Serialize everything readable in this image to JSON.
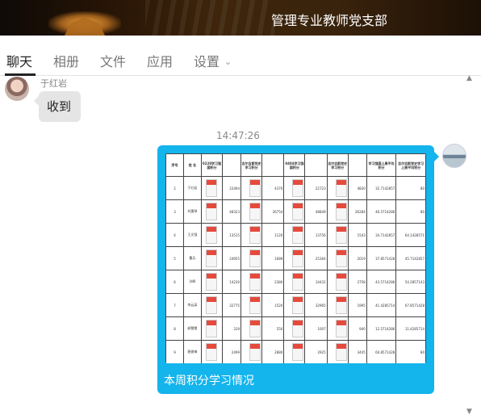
{
  "banner": {
    "title": "管理专业教师党支部"
  },
  "tabs": [
    {
      "label": "聊天",
      "active": true
    },
    {
      "label": "相册"
    },
    {
      "label": "文件"
    },
    {
      "label": "应用"
    },
    {
      "label": "设置"
    }
  ],
  "messages": [
    {
      "sender": "于红岩",
      "text": "收到"
    },
    {
      "time": "14:47:26",
      "caption": "本周积分学习情况"
    }
  ],
  "sheet": {
    "headers": [
      "序号",
      "姓 名",
      "0228学习强国积分",
      "",
      "吉尔吉斯党史学习积分",
      "",
      "0404学习强国积分",
      "",
      "吉尔吉斯党史学习积分",
      "",
      "学习强国上周平均积分",
      "吉尔吉斯党史学习上周平均积分"
    ],
    "rows": [
      [
        "2",
        "于红岩",
        "",
        "22494",
        "",
        "4370",
        "",
        "22723",
        "",
        "4830",
        "32.7142857",
        "80"
      ],
      [
        "3",
        "刘惠琴",
        "",
        "48323",
        "",
        "26754",
        "",
        "48849",
        "",
        "26284",
        "46.5714286",
        "80"
      ],
      [
        "4",
        "王文强",
        "",
        "13515",
        "",
        "1120",
        "",
        "13756",
        "",
        "1543",
        "34.7142857",
        "64.1428571"
      ],
      [
        "5",
        "曹兵",
        "",
        "24955",
        "",
        "1689",
        "",
        "25364",
        "",
        "2019",
        "37.8571428",
        "45.7142857"
      ],
      [
        "6",
        "孙辉",
        "",
        "14230",
        "",
        "2380",
        "",
        "14431",
        "",
        "2758",
        "43.5714286",
        "54.2857143"
      ],
      [
        "7",
        "李云英",
        "",
        "32775",
        "",
        "1520",
        "",
        "32965",
        "",
        "1995",
        "41.4285714",
        "67.8571428"
      ],
      [
        "8",
        "郝慧慧",
        "",
        "319",
        "",
        "550",
        "",
        "1007",
        "",
        "940",
        "12.5714286",
        "11.4285714"
      ],
      [
        "9",
        "聂俊梅",
        "",
        "2499",
        "",
        "2880",
        "",
        "2925",
        "",
        "3445",
        "60.8571428",
        "80"
      ]
    ]
  }
}
